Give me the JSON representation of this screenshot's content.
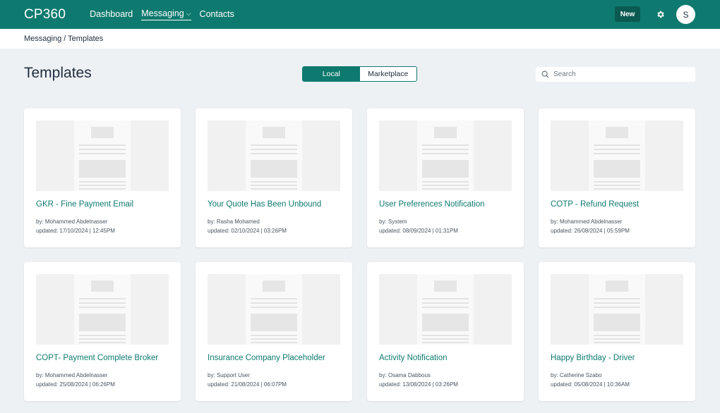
{
  "app": {
    "logo": "CP360"
  },
  "nav": [
    {
      "label": "Dashboard",
      "active": false
    },
    {
      "label": "Messaging",
      "active": true,
      "dropdown": true
    },
    {
      "label": "Contacts",
      "active": false
    }
  ],
  "header": {
    "new_label": "New",
    "settings_icon": "gear-icon",
    "avatar_initial": "S"
  },
  "breadcrumb": "Messaging / Templates",
  "page": {
    "title": "Templates"
  },
  "toggle": {
    "options": [
      "Local",
      "Marketplace"
    ],
    "selected": "Local"
  },
  "search": {
    "placeholder": "Search",
    "value": ""
  },
  "colors": {
    "brand": "#0e7a6f",
    "background": "#eef1f4",
    "title_text": "#0e7a6f"
  },
  "templates": [
    {
      "title": "GKR - Fine Payment Email",
      "author": "by: Mohammed Abdelnasser",
      "updated": "updated: 17/10/2024 | 12:45PM"
    },
    {
      "title": "Your Quote Has Been Unbound",
      "author": "by: Rasha Mohamed",
      "updated": "updated: 02/10/2024 | 03:26PM"
    },
    {
      "title": "User Preferences Notification",
      "author": "by: System",
      "updated": "updated: 08/09/2024 | 01:31PM"
    },
    {
      "title": "COTP - Refund Request",
      "author": "by: Mohammed Abdelnasser",
      "updated": "updated: 26/08/2024 | 05:59PM"
    },
    {
      "title": "COPT- Payment Complete Broker",
      "author": "by: Mohammed Abdelnasser",
      "updated": "updated: 25/08/2024 | 06:26PM"
    },
    {
      "title": "Insurance Company Placeholder",
      "author": "by: Support User",
      "updated": "updated: 21/08/2024 | 06:07PM"
    },
    {
      "title": "Activity Notification",
      "author": "by: Osama Dabbous",
      "updated": "updated: 13/08/2024 | 03:26PM"
    },
    {
      "title": "Happy Birthday - Driver",
      "author": "by: Catherine Szabo",
      "updated": "updated: 05/08/2024 | 10:36AM"
    }
  ]
}
